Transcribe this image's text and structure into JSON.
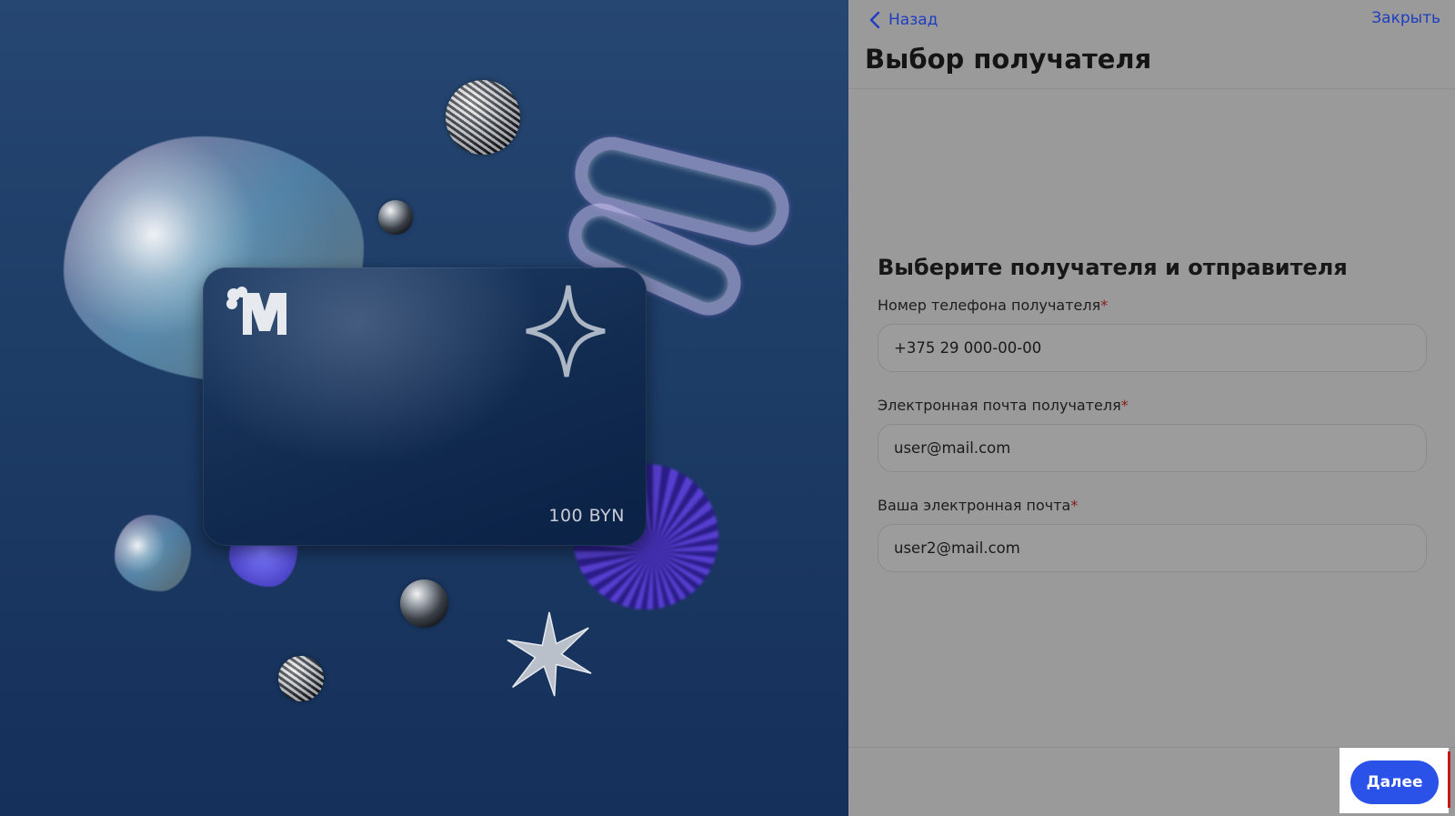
{
  "card": {
    "amount": "100 BYN",
    "logo_icon": "brand-logo-icon",
    "star_icon": "four-point-star-icon"
  },
  "header": {
    "back_label": "Назад",
    "close_label": "Закрыть",
    "title": "Выбор получателя"
  },
  "form": {
    "heading": "Выберите получателя и отправителя",
    "required_mark": "*",
    "fields": [
      {
        "label": "Номер телефона получателя",
        "value": "+375 29 000-00-00"
      },
      {
        "label": "Электронная почта получателя",
        "value": "user@mail.com"
      },
      {
        "label": "Ваша электронная почта",
        "value": "user2@mail.com"
      }
    ]
  },
  "footer": {
    "next_label": "Далее"
  },
  "colors": {
    "accent": "#2a52e8",
    "link": "#1f3dbf",
    "required": "#8b1b1b"
  }
}
